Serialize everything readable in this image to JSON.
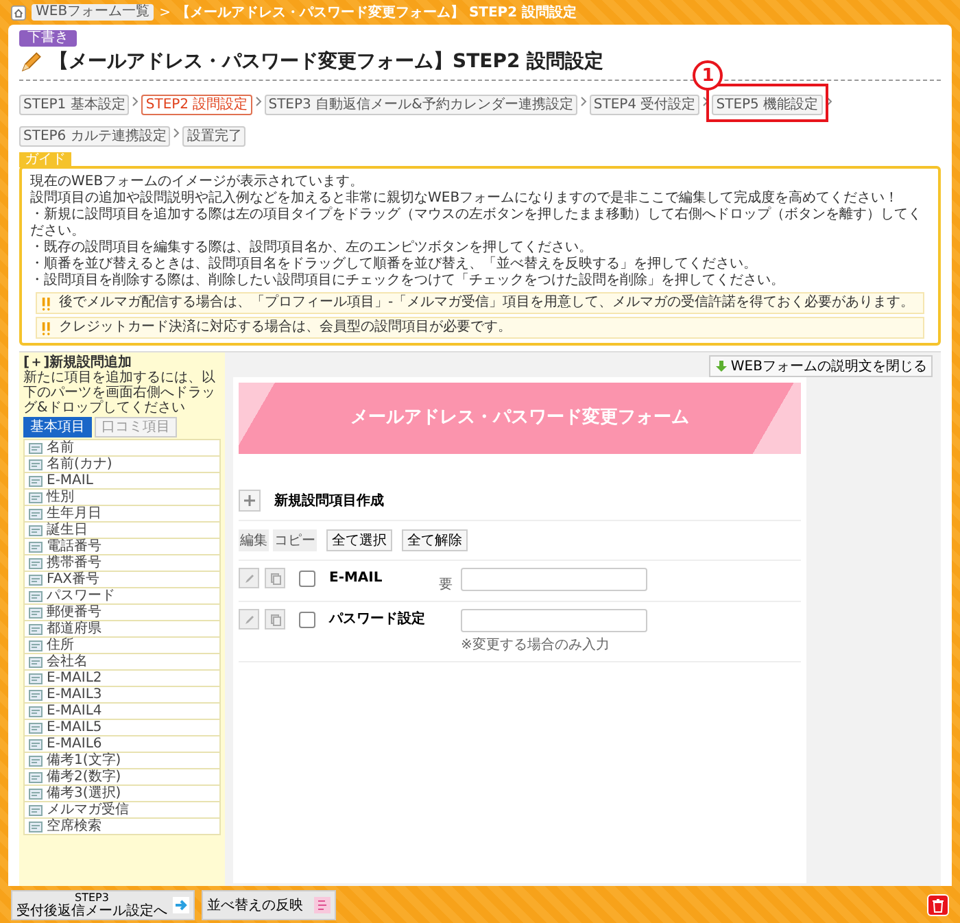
{
  "breadcrumb": {
    "items": [
      "WEBフォーム一覧",
      "【メールアドレス・パスワード変更フォーム】 STEP2 設問設定"
    ],
    "separator": ">"
  },
  "status_badge": "下書き",
  "page_title": "【メールアドレス・パスワード変更フォーム】STEP2 設問設定",
  "steps": [
    {
      "label": "STEP1 基本設定",
      "selected": false
    },
    {
      "label": "STEP2 設問設定",
      "selected": true
    },
    {
      "label": "STEP3 自動返信メール&予約カレンダー連携設定",
      "selected": false
    },
    {
      "label": "STEP4 受付設定",
      "selected": false
    },
    {
      "label": "STEP5 機能設定",
      "selected": false,
      "callout": "1"
    },
    {
      "label": "STEP6 カルテ連携設定",
      "selected": false
    },
    {
      "label": "設置完了",
      "selected": false
    }
  ],
  "guide": {
    "title": "ガイド",
    "lines": [
      "現在のWEBフォームのイメージが表示されています。",
      "設問項目の追加や設問説明や記入例などを加えると非常に親切なWEBフォームになりますので是非ここで編集して完成度を高めてください！",
      "・新規に設問項目を追加する際は左の項目タイプをドラッグ（マウスの左ボタンを押したまま移動）して右側へドロップ（ボタンを離す）してください。",
      "・既存の設問項目を編集する際は、設問項目名か、左のエンピツボタンを押してください。",
      "・順番を並び替えるときは、設問項目名をドラッグして順番を並び替え、「並べ替えを反映する」を押してください。",
      "・設問項目を削除する際は、削除したい設問項目にチェックをつけて「チェックをつけた設問を削除」を押してください。"
    ],
    "notes": [
      "後でメルマガ配信する場合は、「プロフィール項目」-「メルマガ受信」項目を用意して、メルマガの受信許諾を得ておく必要があります。",
      "クレジットカード決済に対応する場合は、会員型の設問項目が必要です。"
    ]
  },
  "sidebar": {
    "title": "[＋]新規設問追加",
    "description": "新たに項目を追加するには、以下のパーツを画面右側へドラッグ&ドロップしてください",
    "tabs": [
      {
        "label": "基本項目",
        "selected": true
      },
      {
        "label": "口コミ項目",
        "selected": false
      }
    ],
    "items": [
      "名前",
      "名前(カナ)",
      "E-MAIL",
      "性別",
      "生年月日",
      "誕生日",
      "電話番号",
      "携帯番号",
      "FAX番号",
      "パスワード",
      "郵便番号",
      "都道府県",
      "住所",
      "会社名",
      "E-MAIL2",
      "E-MAIL3",
      "E-MAIL4",
      "E-MAIL5",
      "E-MAIL6",
      "備考1(文字)",
      "備考2(数字)",
      "備考3(選択)",
      "メルマガ受信",
      "空席検索"
    ]
  },
  "close_description_button": "WEBフォームの説明文を閉じる",
  "form": {
    "banner_title": "メールアドレス・パスワード変更フォーム",
    "new_item_label": "新規設問項目作成",
    "column_labels": [
      "編集",
      "コピー"
    ],
    "select_all": "全て選択",
    "deselect_all": "全て解除",
    "rows": [
      {
        "label": "E-MAIL",
        "required_mark": "要",
        "checked": false
      },
      {
        "label": "パスワード設定",
        "checked": false,
        "note": "※変更する場合のみ入力"
      }
    ]
  },
  "footer": {
    "next_step": {
      "step": "STEP3",
      "label": "受付後返信メール設定へ"
    },
    "apply_order": "並べ替えの反映"
  }
}
